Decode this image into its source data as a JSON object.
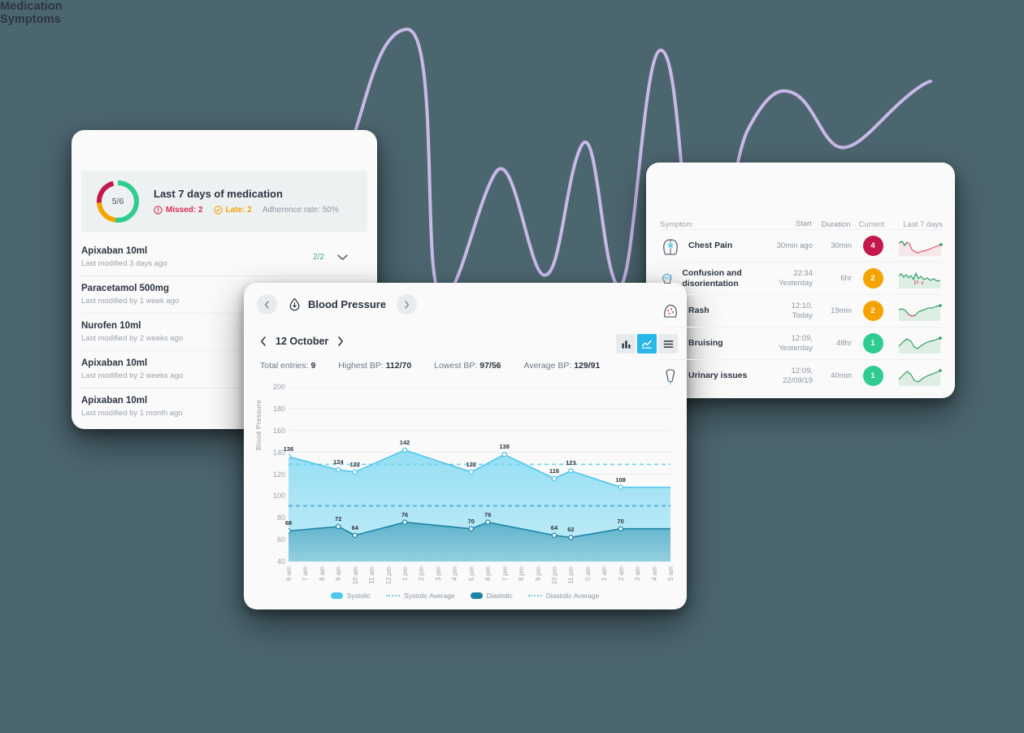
{
  "theme": {
    "page_background": "#4C6670",
    "wave_color": "#C9B8E8",
    "card_background": "#FAFAFA",
    "accent_cyan": "#29B6E8",
    "systolic_color": "#4FC6ED",
    "diastolic_color": "#1B84A6",
    "red": "#E02B4E",
    "orange": "#F5A300",
    "green": "#2ECC8F",
    "crimson": "#C2184B"
  },
  "medication": {
    "title": "Medication",
    "donut": {
      "label": "5/6",
      "segments": [
        {
          "name": "taken",
          "color": "#2ECC8F",
          "percent": 52
        },
        {
          "name": "late",
          "color": "#F5A300",
          "percent": 22
        },
        {
          "name": "missed",
          "color": "#C2184B",
          "percent": 22
        }
      ]
    },
    "summary_heading": "Last 7 days of medication",
    "missed_label": "Missed: 2",
    "late_label": "Late: 2",
    "adherence_label": "Adherence rate: 50%",
    "items": [
      {
        "name": "Apixaban 10ml",
        "sub": "Last modified 3 days ago",
        "count": "2/2",
        "expandable": true
      },
      {
        "name": "Paracetamol 500mg",
        "sub": "Last modified by 1 week ago",
        "count": "",
        "expandable": false
      },
      {
        "name": "Nurofen 10ml",
        "sub": "Last modified by 2 weeks ago",
        "count": "",
        "expandable": false
      },
      {
        "name": "Apixaban 10ml",
        "sub": "Last modified by 2 weeks ago",
        "count": "",
        "expandable": false
      },
      {
        "name": "Apixaban 10ml",
        "sub": "Last modified by 1 month ago",
        "count": "",
        "expandable": false
      }
    ]
  },
  "blood_pressure": {
    "title": "Blood Pressure",
    "date": "12 October",
    "stats": [
      {
        "label": "Total entries: ",
        "value": "9"
      },
      {
        "label": "Highest BP: ",
        "value": "112/70"
      },
      {
        "label": "Lowest BP: ",
        "value": "97/56"
      },
      {
        "label": "Average BP: ",
        "value": "129/91"
      }
    ],
    "view_toggle": {
      "options": [
        "bar-chart",
        "line-chart",
        "list"
      ],
      "selected": "line-chart"
    },
    "legend": [
      {
        "label": "Systolic",
        "type": "area",
        "color": "#4FC6ED"
      },
      {
        "label": "Systolic Average",
        "type": "dashed",
        "color": "#6FCFE8"
      },
      {
        "label": "Diastolic",
        "type": "area",
        "color": "#1B84A6"
      },
      {
        "label": "Diastolic Average",
        "type": "dashed",
        "color": "#6FCFE8"
      }
    ]
  },
  "chart_data": {
    "type": "line",
    "title": "Blood Pressure",
    "xlabel": "",
    "ylabel": "Blood Pressure",
    "ylim": [
      40,
      200
    ],
    "yticks": [
      40,
      60,
      80,
      100,
      120,
      140,
      160,
      180,
      200
    ],
    "grid": true,
    "legend_position": "bottom",
    "x": [
      "6 am",
      "7 am",
      "8 am",
      "9 am",
      "10 am",
      "11 am",
      "12 pm",
      "1 pm",
      "2 pm",
      "3 pm",
      "4 pm",
      "5 pm",
      "6 pm",
      "7 pm",
      "8 pm",
      "9 pm",
      "10 pm",
      "11 pm",
      "0 am",
      "1 am",
      "2 am",
      "3 am",
      "4 am",
      "5 am"
    ],
    "series": [
      {
        "name": "Systolic",
        "color": "#4FC6ED",
        "points": [
          {
            "x": "6 am",
            "value": 136
          },
          {
            "x": "9 am",
            "value": 124
          },
          {
            "x": "10 am",
            "value": 122
          },
          {
            "x": "1 pm",
            "value": 142
          },
          {
            "x": "5 pm",
            "value": 122
          },
          {
            "x": "7 pm",
            "value": 138
          },
          {
            "x": "10 pm",
            "value": 116
          },
          {
            "x": "11 pm",
            "value": 123
          },
          {
            "x": "2 am",
            "value": 108
          }
        ]
      },
      {
        "name": "Diastolic",
        "color": "#1B84A6",
        "points": [
          {
            "x": "6 am",
            "value": 68
          },
          {
            "x": "9 am",
            "value": 72
          },
          {
            "x": "10 am",
            "value": 64
          },
          {
            "x": "1 pm",
            "value": 76
          },
          {
            "x": "5 pm",
            "value": 70
          },
          {
            "x": "6 pm",
            "value": 76
          },
          {
            "x": "10 pm",
            "value": 64
          },
          {
            "x": "11 pm",
            "value": 62
          },
          {
            "x": "2 am",
            "value": 70
          }
        ]
      }
    ],
    "reference_lines": [
      {
        "name": "Systolic Average",
        "value": 129,
        "color": "#6FCFE8",
        "style": "dashed"
      },
      {
        "name": "Diastolic Average",
        "value": 91,
        "color": "#4AA8C8",
        "style": "dashed"
      }
    ]
  },
  "symptoms": {
    "title": "Symptoms",
    "columns": [
      "Symptom",
      "Start",
      "Duration",
      "Current",
      "Last 7 days"
    ],
    "rows": [
      {
        "icon": "torso-pain-icon",
        "name": "Chest Pain",
        "start": "30min ago",
        "duration": "30min",
        "current": "4",
        "current_color": "#C2184B",
        "trend": "down"
      },
      {
        "icon": "head-dizzy-icon",
        "name": "Confusion and disorientation",
        "start": "22:34\nYesterday",
        "duration": "6hr",
        "current": "2",
        "current_color": "#F5A300",
        "trend": "volatile"
      },
      {
        "icon": "skin-rash-icon",
        "name": "Rash",
        "start": "12:10,\nToday",
        "duration": "19min",
        "current": "2",
        "current_color": "#F5A300",
        "trend": "up"
      },
      {
        "icon": "bruise-icon",
        "name": "Bruising",
        "start": "12:09,\nYesterday",
        "duration": "48hr",
        "current": "1",
        "current_color": "#2ECC8F",
        "trend": "up"
      },
      {
        "icon": "urinary-icon",
        "name": "Urinary issues",
        "start": "12:09,\n22/09/19",
        "duration": "40min",
        "current": "1",
        "current_color": "#2ECC8F",
        "trend": "up"
      }
    ]
  }
}
